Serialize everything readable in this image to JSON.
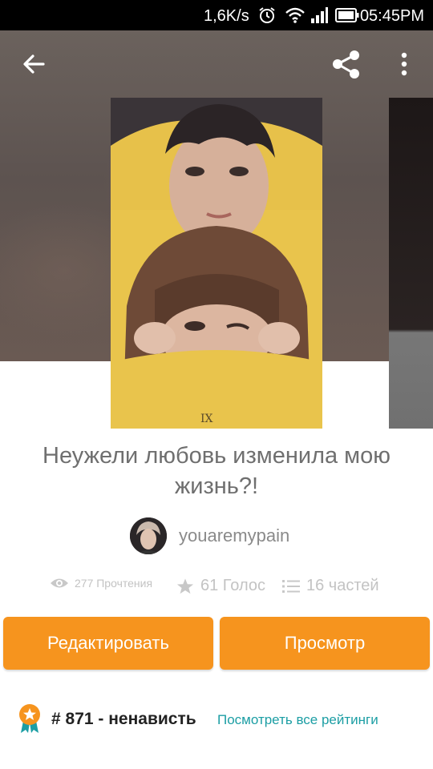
{
  "status_bar": {
    "network_speed": "1,6K/s",
    "time": "05:45PM",
    "icons": [
      "alarm-icon",
      "wifi-icon",
      "signal-icon",
      "battery-icon"
    ]
  },
  "toolbar": {
    "icons": [
      "back-arrow-icon",
      "share-icon",
      "more-vertical-icon"
    ]
  },
  "story": {
    "title": "Неужели любовь изменила мою жизнь?!",
    "author": "youaremypain",
    "reads": "277 Прочтения",
    "votes": "61 Голос",
    "parts": "16 частей"
  },
  "actions": {
    "edit_label": "Редактировать",
    "view_label": "Просмотр"
  },
  "ranking": {
    "rank_text": "# 871 - ненависть",
    "all_ratings_link": "Посмотреть все рейтинги"
  },
  "colors": {
    "accent": "#f6941e",
    "link": "#1c9ea4",
    "title_text": "#6f6f6f",
    "muted": "#c3c3c3"
  }
}
